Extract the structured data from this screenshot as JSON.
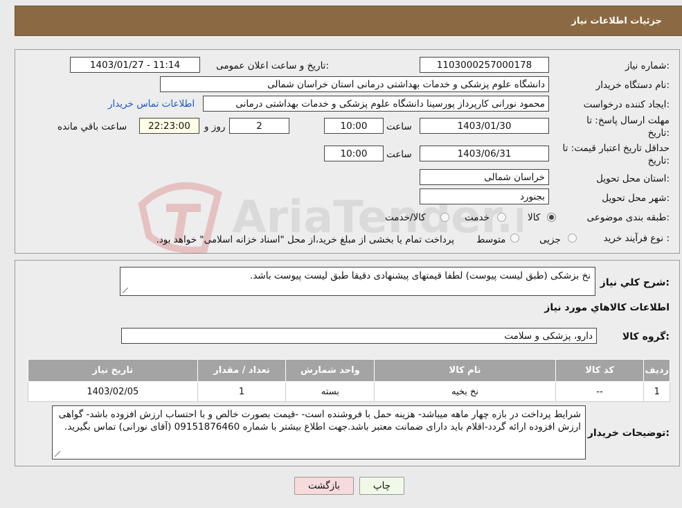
{
  "header": {
    "title": "جزئیات اطلاعات نیاز"
  },
  "fields": {
    "need_number_label": "شماره نیاز:",
    "need_number": "1103000257000178",
    "announce_label": "تاریخ و ساعت اعلان عمومی:",
    "announce_value": "1403/01/27 - 11:14",
    "buyer_org_label": "نام دستگاه خریدار:",
    "buyer_org": "دانشگاه علوم پزشکی و خدمات بهداشتی درمانی استان خراسان شمالی",
    "creator_label": "ایجاد کننده درخواست:",
    "creator": "محمود نورانی کارپرداز پورسینا دانشگاه علوم پزشکی و خدمات بهداشتی درمانی",
    "contact_link": "اطلاعات تماس خریدار",
    "deadline_label_1": "مهلت ارسال پاسخ: تا",
    "deadline_label_2": "تاریخ:",
    "deadline_date": "1403/01/30",
    "hour_label": "ساعت",
    "deadline_hour": "10:00",
    "days_value": "2",
    "days_label": "روز و",
    "remaining_time": "22:23:00",
    "remaining_label": "ساعت باقي مانده",
    "validity_label_1": "حداقل تاریخ اعتبار قیمت: تا",
    "validity_label_2": "تاریخ:",
    "validity_date": "1403/06/31",
    "validity_hour_label": "ساعت",
    "validity_hour": "10:00",
    "province_label": "استان محل تحویل:",
    "province": "خراسان شمالی",
    "city_label": "شهر محل تحویل:",
    "city": "بجنورد",
    "category_label": "طبقه بندی موضوعی:",
    "category_options": [
      "کالا",
      "خدمت",
      "کالا/خدمت"
    ],
    "category_selected": "کالا",
    "process_label": "نوع فرآیند خرید :",
    "process_options": [
      "جزیی",
      "متوسط"
    ],
    "process_note": "پرداخت تمام یا بخشی از مبلغ خرید،از محل \"اسناد خزانه اسلامی\" خواهد بود."
  },
  "summary": {
    "label": "شرح کلي نياز:",
    "text": "نخ بزشکی (طبق لیست پیوست) لطفا قیمتهای پیشنهادی دقیقا طبق لیست پیوست باشد."
  },
  "goods": {
    "section_title": "اطلاعات کالاهاي مورد نياز",
    "group_label": "گروه کالا:",
    "group_value": "دارو، پزشکی و سلامت",
    "columns": [
      "رديف",
      "کد کالا",
      "نام کالا",
      "واحد شمارش",
      "تعداد / مقدار",
      "تاريخ نياز"
    ],
    "rows": [
      [
        "1",
        "--",
        "نخ بخیه",
        "بسته",
        "1",
        "1403/02/05"
      ]
    ]
  },
  "buyer_notes": {
    "label": "توضیحات خریدار:",
    "text": "شرایط پرداخت در بازه چهار ماهه میباشد- هزینه حمل با فروشنده است- -قیمت بصورت خالص و با احتساب ارزش افزوده باشد- گواهی ارزش افزوده ارائه گردد-اقلام باید دارای ضمانت معتبر باشد.جهت اطلاع بیشتر با شماره 09151876460 (آقای نورانی) تماس بگیرید."
  },
  "buttons": {
    "print": "چاپ",
    "back": "بازگشت"
  },
  "watermark": {
    "text": "AriaTender.neT"
  },
  "colors": {
    "header_bg": "#8b6a43",
    "table_header_bg": "#a4a4a4",
    "back_button_bg": "#f7dada",
    "print_button_bg": "#f0f9e8",
    "link": "#1a56c9"
  }
}
